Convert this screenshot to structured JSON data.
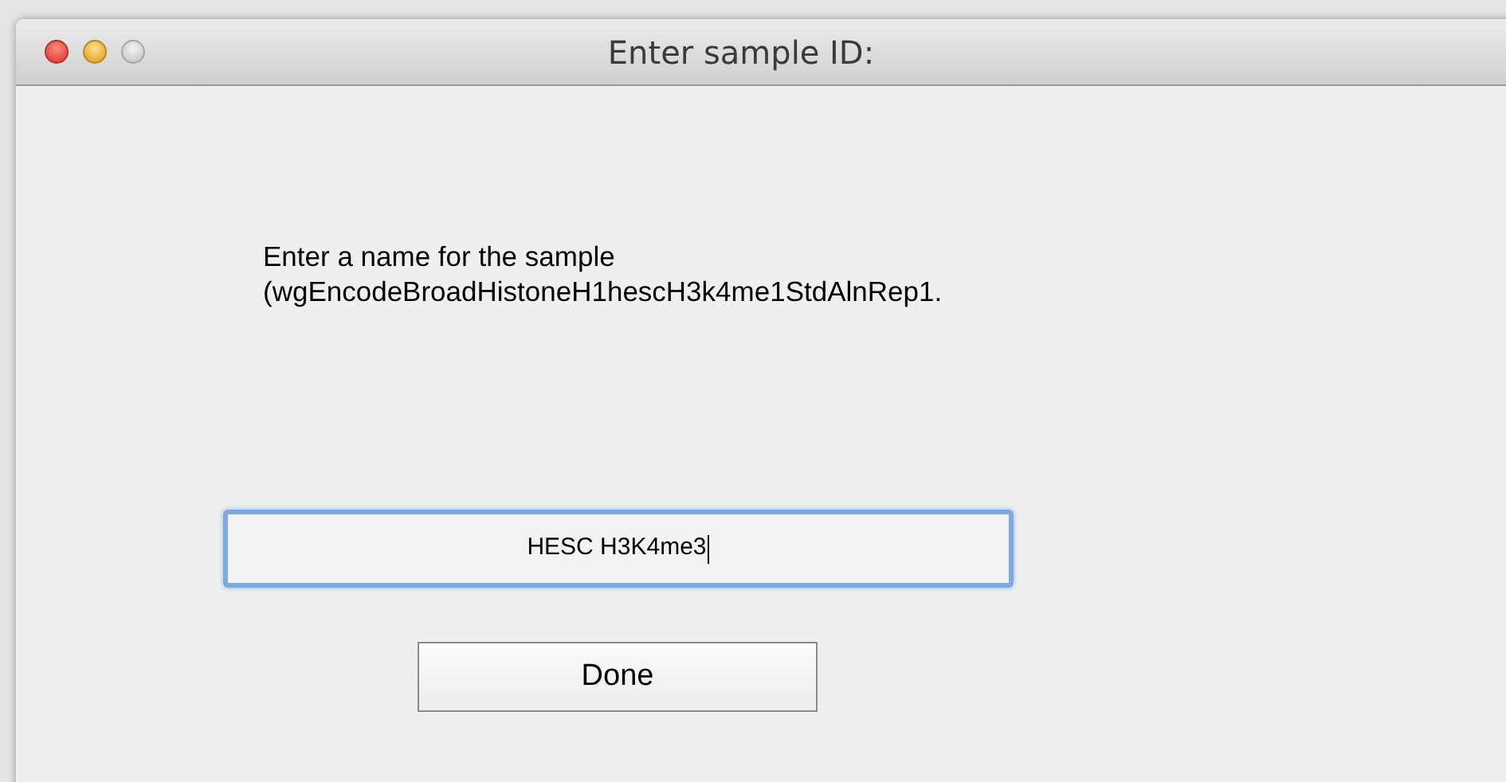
{
  "window": {
    "title": "Enter sample ID:"
  },
  "prompt": "Enter a name for the sample\n(wgEncodeBroadHistoneH1hescH3k4me1StdAlnRep1.",
  "name_field": {
    "value": "HESC H3K4me3",
    "focused": true
  },
  "buttons": [
    {
      "label": "Done"
    }
  ]
}
